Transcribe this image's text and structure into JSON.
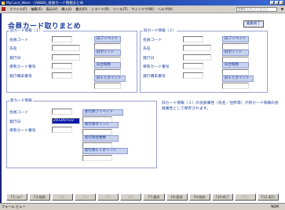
{
  "window": {
    "title": "MyCard_Work - [ABBB]_会員カード情報まとめ"
  },
  "menu": {
    "items": [
      "ファイル(F)",
      "編集(E)",
      "表示(V)",
      "挿入(I)",
      "書式(O)",
      "レコード(R)",
      "ツール(T)",
      "ウィンドウ(W)",
      "ヘルプ(H)"
    ],
    "hint": "質問を入力してください",
    "arrow": "▼"
  },
  "page": {
    "title": "会員カード取りまとめ",
    "end_button": "編集終了"
  },
  "panel1": {
    "title": "旧カード情報（１）",
    "labels": [
      "会員コード",
      "氏名",
      "発行日",
      "保有カード番号",
      "発行端末番号"
    ],
    "values": [
      "",
      "",
      "",
      "",
      ""
    ],
    "buttons": [
      "旧プリペイド",
      "旧ポイント",
      "旧台帳数",
      "旧ＥＣポイント"
    ],
    "btn_values": [
      "",
      "",
      "",
      ""
    ]
  },
  "panel2": {
    "title": "旧カード情報（２）",
    "labels": [
      "会員コード",
      "氏名",
      "発行日",
      "保有カード番号",
      "発行端末番号"
    ],
    "values": [
      "",
      "",
      "",
      "",
      ""
    ],
    "buttons": [
      "旧プリペイド",
      "旧ポイント",
      "旧台帳数",
      "旧ＥＣポイント"
    ],
    "btn_values": [
      "",
      "",
      "",
      ""
    ]
  },
  "panel3": {
    "title": "新カード情報",
    "labels": [
      "会員コード",
      "発行日",
      "保有カード番号"
    ],
    "values": [
      "",
      "2013/07/22",
      ""
    ],
    "buttons": [
      "新行政プリペイド",
      "新行政ポイント",
      "新行政台数数",
      "新行政ＥＣポイント"
    ],
    "btn_values": [
      "",
      "",
      "",
      ""
    ]
  },
  "notice": {
    "text": "旧カード情報（１）の会員属性（氏名／住所等）が新カード情報の会員属性として保存されます。"
  },
  "footer": {
    "buttons": [
      "F1:ﾍﾙﾌﾟ",
      "F2:検索",
      "F3:",
      "F4:",
      "F5:",
      "F6:",
      "F7:選択",
      "F8:登録",
      "F9:削除",
      "F10:終了",
      "F11:",
      "F12:実行"
    ]
  },
  "statusbar": {
    "left": "フォーム ビュー",
    "right": "NUM"
  },
  "colors": {
    "accent": "#1a3c9c",
    "title_bar": "#0b2a86",
    "highlight": "#0c1aa8"
  }
}
